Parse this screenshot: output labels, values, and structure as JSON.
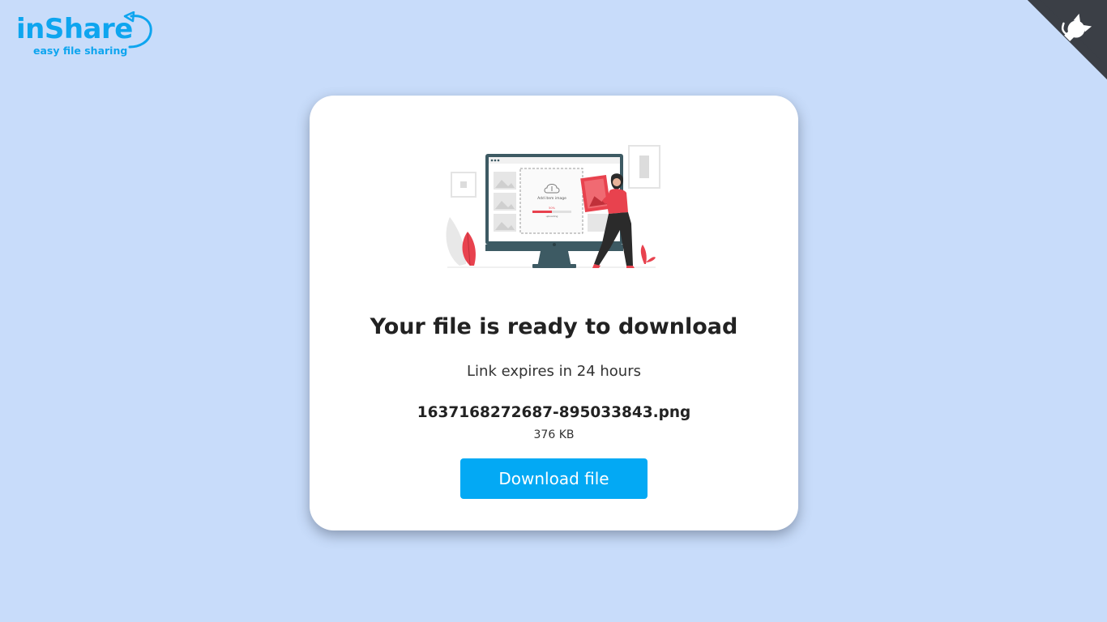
{
  "logo": {
    "main_text": "inShare",
    "tagline": "easy file sharing"
  },
  "github_corner": {
    "icon": "github-octocat-icon"
  },
  "illustration": {
    "screen_label": "Add item image",
    "progress_label": "uploading",
    "progress_percent": 50,
    "percent_text": "50%"
  },
  "download": {
    "title": "Your file is ready to download",
    "expires_text": "Link expires in 24 hours",
    "file_name": "1637168272687-895033843.png",
    "file_size": "376 KB",
    "button_label": "Download file"
  },
  "colors": {
    "background": "#c8dcfa",
    "brand": "#0ea5ef",
    "button": "#03a9f4",
    "accent": "#e8424e",
    "corner": "#3b3f46"
  }
}
